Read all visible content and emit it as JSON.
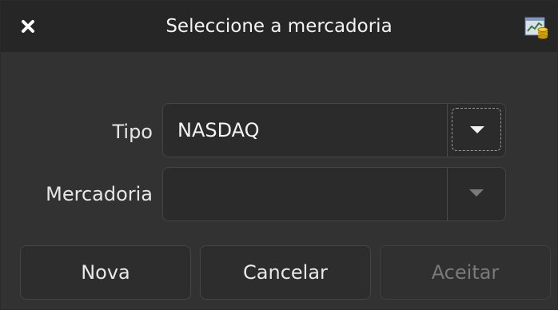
{
  "window": {
    "title": "Seleccione a mercadoria",
    "close_icon": "close-icon",
    "app_icon": "chart-money-icon"
  },
  "form": {
    "tipo": {
      "label": "Tipo",
      "value": "NASDAQ",
      "focused": true
    },
    "mercadoria": {
      "label": "Mercadoria",
      "value": "",
      "enabled": false
    }
  },
  "buttons": {
    "nova": "Nova",
    "cancelar": "Cancelar",
    "aceitar": "Aceitar",
    "aceitar_enabled": false
  },
  "colors": {
    "window_bg": "#323232",
    "titlebar_bg": "#262626",
    "text": "#e6e6e6",
    "disabled_text": "#7a7a7a"
  }
}
